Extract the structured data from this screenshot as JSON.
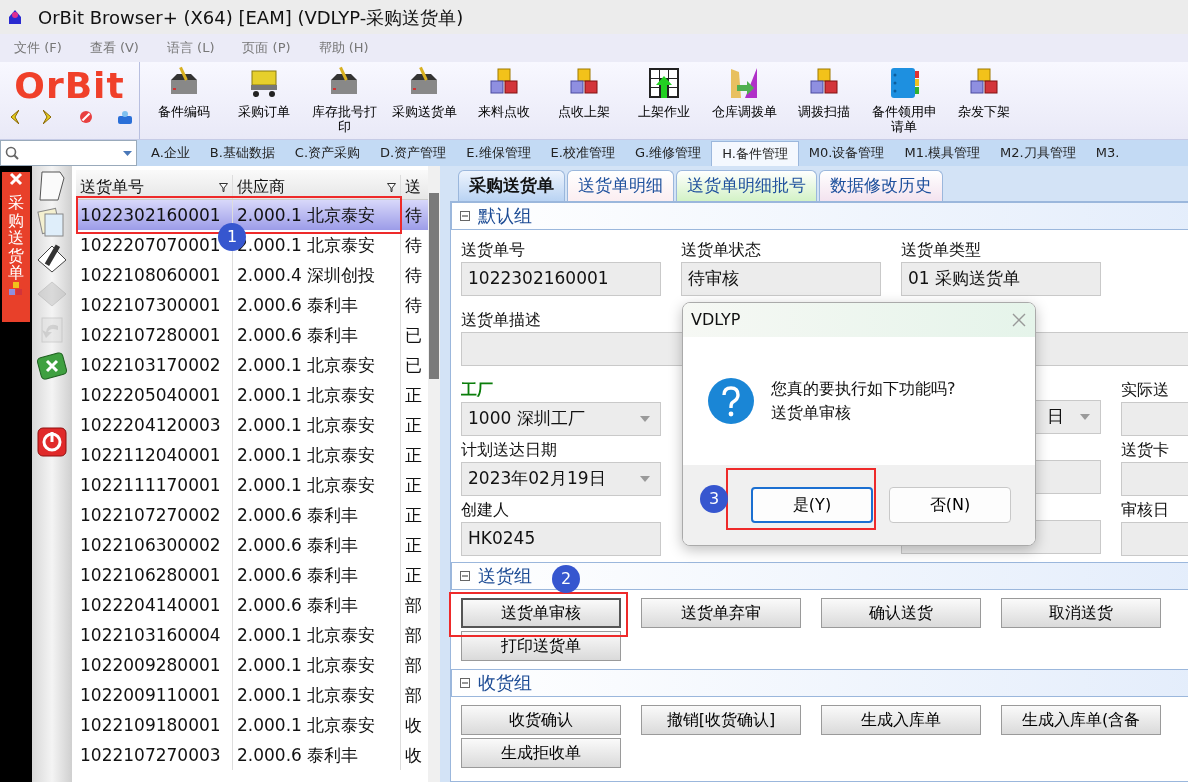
{
  "window": {
    "title": "OrBit Browser+ (X64) [EAM] (VDLYP-采购送货单)"
  },
  "menu": [
    "文件 (F)",
    "查看 (V)",
    "语言 (L)",
    "页面 (P)",
    "帮助 (H)"
  ],
  "logo": {
    "text": "OrBit"
  },
  "toolbar": [
    {
      "label": "备件编码",
      "kind": "tray"
    },
    {
      "label": "采购订单",
      "kind": "cart"
    },
    {
      "label": "库存批号打印",
      "kind": "tray"
    },
    {
      "label": "采购送货单",
      "kind": "tray"
    },
    {
      "label": "来料点收",
      "kind": "cubes"
    },
    {
      "label": "点收上架",
      "kind": "cubes"
    },
    {
      "label": "上架作业",
      "kind": "grid"
    },
    {
      "label": "仓库调拨单",
      "kind": "transfer"
    },
    {
      "label": "调拨扫描",
      "kind": "cubes"
    },
    {
      "label": "备件领用申请单",
      "kind": "book"
    },
    {
      "label": "杂发下架",
      "kind": "cubes"
    }
  ],
  "module_tabs": [
    {
      "label": "A.企业",
      "selected": false
    },
    {
      "label": "B.基础数据",
      "selected": false
    },
    {
      "label": "C.资产采购",
      "selected": false
    },
    {
      "label": "D.资产管理",
      "selected": false
    },
    {
      "label": "E.维保管理",
      "selected": false
    },
    {
      "label": "E.校准管理",
      "selected": false
    },
    {
      "label": "G.维修管理",
      "selected": false
    },
    {
      "label": "H.备件管理",
      "selected": true
    },
    {
      "label": "M0.设备管理",
      "selected": false
    },
    {
      "label": "M1.模具管理",
      "selected": false
    },
    {
      "label": "M2.刀具管理",
      "selected": false
    },
    {
      "label": "M3.",
      "selected": false
    }
  ],
  "side_tab": {
    "label": "采购送货单"
  },
  "side_tools": [
    {
      "kind": "page",
      "disabled": false
    },
    {
      "kind": "pages",
      "disabled": false
    },
    {
      "kind": "pencil",
      "disabled": false
    },
    {
      "kind": "diamond",
      "disabled": true
    },
    {
      "kind": "undo",
      "disabled": true
    },
    {
      "kind": "cancel",
      "disabled": false
    },
    {
      "kind": "power",
      "disabled": false
    }
  ],
  "list": {
    "columns": [
      "送货单号",
      "供应商",
      "送"
    ],
    "rows": [
      {
        "cells": [
          "1022302160001",
          "2.000.1 北京泰安",
          "待"
        ],
        "selected": true
      },
      {
        "cells": [
          "1022207070001",
          "2.000.1 北京泰安",
          "待"
        ],
        "selected": false
      },
      {
        "cells": [
          "1022108060001",
          "2.000.4 深圳创投",
          "待"
        ],
        "selected": false
      },
      {
        "cells": [
          "1022107300001",
          "2.000.6 泰利丰",
          "待"
        ],
        "selected": false
      },
      {
        "cells": [
          "1022107280001",
          "2.000.6 泰利丰",
          "已"
        ],
        "selected": false
      },
      {
        "cells": [
          "1022103170002",
          "2.000.1 北京泰安",
          "已"
        ],
        "selected": false
      },
      {
        "cells": [
          "1022205040001",
          "2.000.1 北京泰安",
          "正"
        ],
        "selected": false
      },
      {
        "cells": [
          "1022204120003",
          "2.000.1 北京泰安",
          "正"
        ],
        "selected": false
      },
      {
        "cells": [
          "1022112040001",
          "2.000.1 北京泰安",
          "正"
        ],
        "selected": false
      },
      {
        "cells": [
          "1022111170001",
          "2.000.1 北京泰安",
          "正"
        ],
        "selected": false
      },
      {
        "cells": [
          "1022107270002",
          "2.000.6 泰利丰",
          "正"
        ],
        "selected": false
      },
      {
        "cells": [
          "1022106300002",
          "2.000.6 泰利丰",
          "正"
        ],
        "selected": false
      },
      {
        "cells": [
          "1022106280001",
          "2.000.6 泰利丰",
          "正"
        ],
        "selected": false
      },
      {
        "cells": [
          "1022204140001",
          "2.000.6 泰利丰",
          "部"
        ],
        "selected": false
      },
      {
        "cells": [
          "1022103160004",
          "2.000.1 北京泰安",
          "部"
        ],
        "selected": false
      },
      {
        "cells": [
          "1022009280001",
          "2.000.1 北京泰安",
          "部"
        ],
        "selected": false
      },
      {
        "cells": [
          "1022009110001",
          "2.000.1 北京泰安",
          "部"
        ],
        "selected": false
      },
      {
        "cells": [
          "1022109180001",
          "2.000.1 北京泰安",
          "收"
        ],
        "selected": false
      },
      {
        "cells": [
          "1022107270003",
          "2.000.6 泰利丰",
          "收"
        ],
        "selected": false
      }
    ]
  },
  "form_tabs": [
    {
      "label": "采购送货单",
      "selected": true,
      "color": "#b9d3f3"
    },
    {
      "label": "送货单明细",
      "selected": false,
      "color": "#fbeef1"
    },
    {
      "label": "送货单明细批号",
      "selected": false,
      "color": "#d3f2c6"
    },
    {
      "label": "数据修改历史",
      "selected": false,
      "color": "#f3e3ef"
    }
  ],
  "default_group": {
    "title": "默认组",
    "expanded": true,
    "rows": [
      [
        {
          "kind": "text",
          "label": "送货单号",
          "value": "1022302160001"
        },
        {
          "kind": "text",
          "label": "送货单状态",
          "value": "待审核"
        },
        {
          "kind": "text",
          "label": "送货单类型",
          "value": "01 采购送货单"
        },
        {
          "kind": "blank"
        }
      ],
      [
        {
          "kind": "wide",
          "label": "送货单描述"
        }
      ],
      [
        {
          "kind": "select",
          "label": "工厂",
          "value": "1000 深圳工厂",
          "required": true
        },
        {
          "kind": "blank"
        },
        {
          "kind": "select",
          "value": "日"
        },
        {
          "kind": "text",
          "label": "实际送"
        }
      ],
      [
        {
          "kind": "select",
          "label": "计划送达日期",
          "value": "2023年02月19日"
        },
        {
          "kind": "blank"
        },
        {
          "kind": "text"
        },
        {
          "kind": "text",
          "label": "送货卡"
        }
      ],
      [
        {
          "kind": "text",
          "label": "创建人",
          "value": "HK0245"
        },
        {
          "kind": "blank"
        },
        {
          "kind": "text"
        },
        {
          "kind": "text",
          "label": "审核日"
        }
      ]
    ]
  },
  "action_groups": [
    {
      "title": "送货组",
      "expanded": true,
      "buttons": [
        {
          "label": "送货单审核",
          "focused": true
        },
        {
          "label": "送货单弃审",
          "focused": false
        },
        {
          "label": "确认送货",
          "focused": false
        },
        {
          "label": "取消送货",
          "focused": false
        },
        {
          "label": "打印送货单",
          "focused": false
        }
      ]
    },
    {
      "title": "收货组",
      "expanded": true,
      "buttons": [
        {
          "label": "收货确认",
          "focused": false
        },
        {
          "label": "撤销[收货确认]",
          "focused": false
        },
        {
          "label": "生成入库单",
          "focused": false
        },
        {
          "label": "生成入库单(含备",
          "focused": false
        },
        {
          "label": "生成拒收单",
          "focused": false
        }
      ]
    }
  ],
  "dialog": {
    "title": "VDLYP",
    "message": "您真的要执行如下功能吗?",
    "function": "送货单审核",
    "buttons": [
      {
        "label": "是(Y)",
        "focused": true
      },
      {
        "label": "否(N)",
        "focused": false
      }
    ]
  },
  "annotations": [
    {
      "label": "1"
    },
    {
      "label": "2"
    },
    {
      "label": "3"
    }
  ]
}
